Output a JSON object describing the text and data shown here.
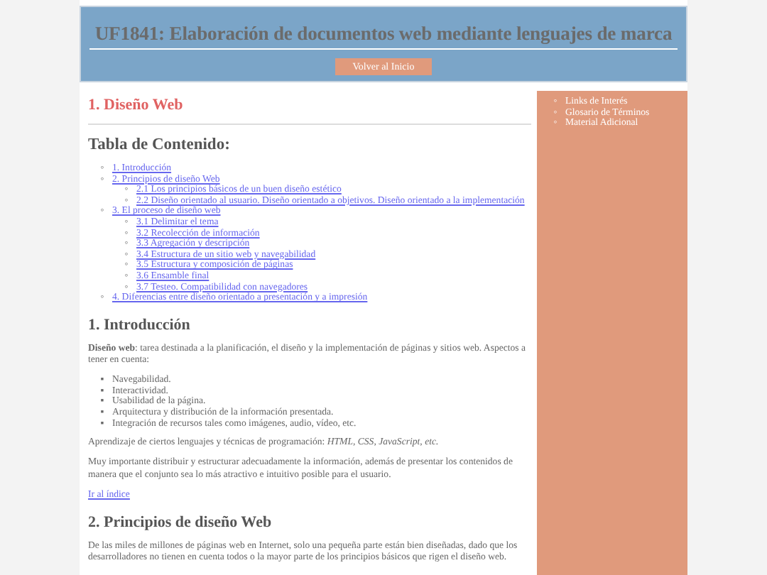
{
  "header": {
    "title": "UF1841: Elaboración de documentos web mediante lenguajes de marca",
    "button": "Volver al Inicio"
  },
  "main": {
    "page_title": "1. Diseño Web",
    "toc_title": "Tabla de Contenido:",
    "toc_marker": "◦",
    "toc": [
      {
        "label": "1. Introducción"
      },
      {
        "label": "2. Principios de diseño Web",
        "children": [
          {
            "label": "2.1 Los principios básicos de un buen diseño estético"
          },
          {
            "label": "2.2 Diseño orientado al usuario. Diseño orientado a objetivos. Diseño orientado a la implementación"
          }
        ]
      },
      {
        "label": "3. El proceso de diseño web",
        "children": [
          {
            "label": "3.1 Delimitar el tema"
          },
          {
            "label": "3.2 Recolección de información"
          },
          {
            "label": "3.3 Agregación y descripción"
          },
          {
            "label": "3.4 Estructura de un sitio web y navegabilidad"
          },
          {
            "label": "3.5 Estructura y composición de páginas"
          },
          {
            "label": "3.6 Ensamble final"
          },
          {
            "label": "3.7 Testeo. Compatibilidad con navegadores"
          }
        ]
      },
      {
        "label": "4. Diferencias entre diseño orientado a presentación y a impresión"
      }
    ],
    "sections": [
      {
        "heading": "1. Introducción",
        "blocks": [
          {
            "kind": "paragraph",
            "text": "**Diseño web**: tarea destinada a la planificación, el diseño y la implementación de páginas y sitios web. Aspectos a tener en cuenta:"
          },
          {
            "kind": "list",
            "marker": "▪",
            "items": [
              "Navegabilidad.",
              "Interactividad.",
              "Usabilidad de la página.",
              "Arquitectura y distribución de la información presentada.",
              "Integración de recursos tales como imágenes, audio, vídeo, etc."
            ]
          },
          {
            "kind": "paragraph",
            "text": "Aprendizaje de ciertos lenguajes y técnicas de programación: *HTML, CSS, JavaScript, etc.*"
          },
          {
            "kind": "paragraph",
            "text": "Muy importante distribuir y estructurar adecuadamente la información, además de presentar los contenidos de manera que el conjunto sea lo más atractivo e intuitivo posible para el usuario."
          },
          {
            "kind": "link",
            "text": "Ir al índice"
          }
        ]
      },
      {
        "heading": "2. Principios de diseño Web",
        "blocks": [
          {
            "kind": "paragraph",
            "text": "De las miles de millones de páginas web en Internet, solo una pequeña parte están bien diseñadas, dado que los desarrolladores no tienen en cuenta todos o la mayor parte de los principios básicos que rigen el diseño web."
          }
        ]
      }
    ]
  },
  "sidebar": {
    "marker": "◦",
    "links": [
      "Links de Interés",
      "Glosario de Términos",
      "Material Adicional"
    ]
  }
}
